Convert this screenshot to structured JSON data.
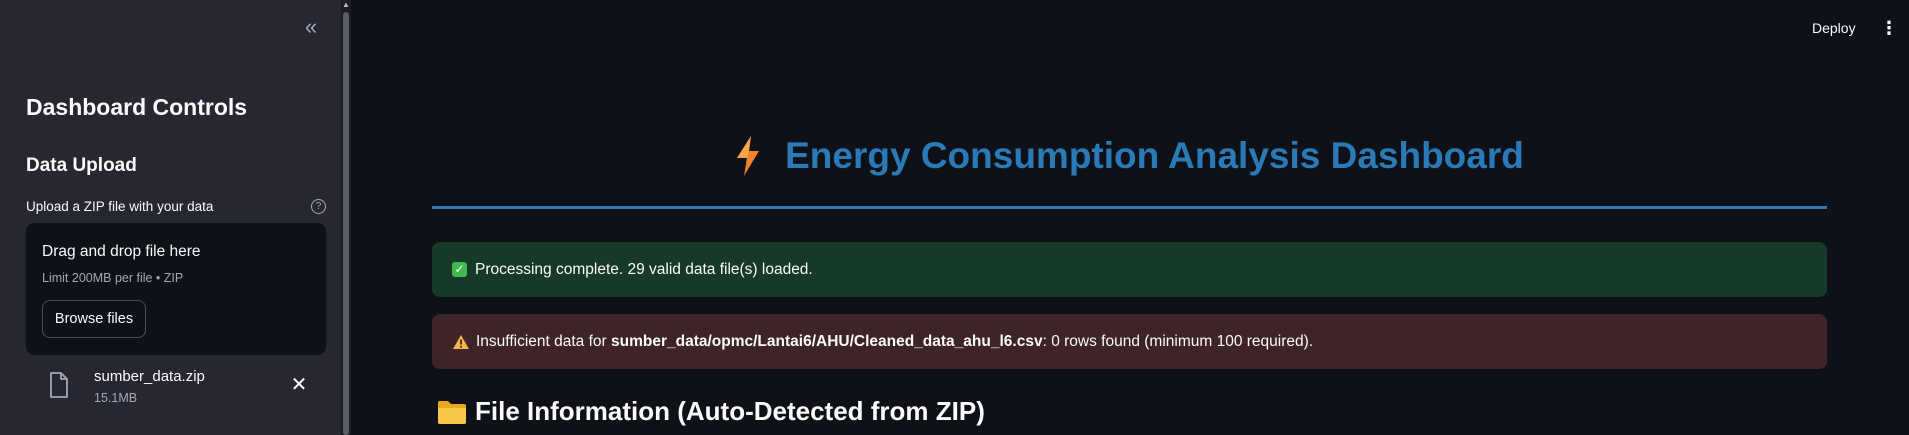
{
  "sidebar": {
    "collapse_icon": "double-chevron-left-icon",
    "title": "Dashboard Controls",
    "subtitle": "Data Upload",
    "upload_label": "Upload a ZIP file with your data",
    "help_icon": "question-circle-icon",
    "dropzone": {
      "title": "Drag and drop file here",
      "limit": "Limit 200MB per file • ZIP",
      "browse_label": "Browse files"
    },
    "file": {
      "name": "sumber_data.zip",
      "size": "15.1MB"
    }
  },
  "header": {
    "deploy_label": "Deploy",
    "menu_icon": "vertical-ellipsis-icon"
  },
  "main": {
    "title": "Energy Consumption Analysis Dashboard",
    "title_icon": "lightning-bolt-icon",
    "success_message": "Processing complete. 29 valid data file(s) loaded.",
    "warning": {
      "prefix": "Insufficient data for ",
      "path": "sumber_data/opmc/Lantai6/AHU/Cleaned_data_ahu_l6.csv",
      "suffix": ": 0 rows found (minimum 100 required)."
    },
    "section_title": "File Information (Auto-Detected from ZIP)"
  },
  "colors": {
    "title_blue": "#2a7ab8",
    "success_bg": "#173928",
    "warning_bg": "#3e2428",
    "sidebar_bg": "#262730",
    "main_bg": "#0e1117"
  }
}
